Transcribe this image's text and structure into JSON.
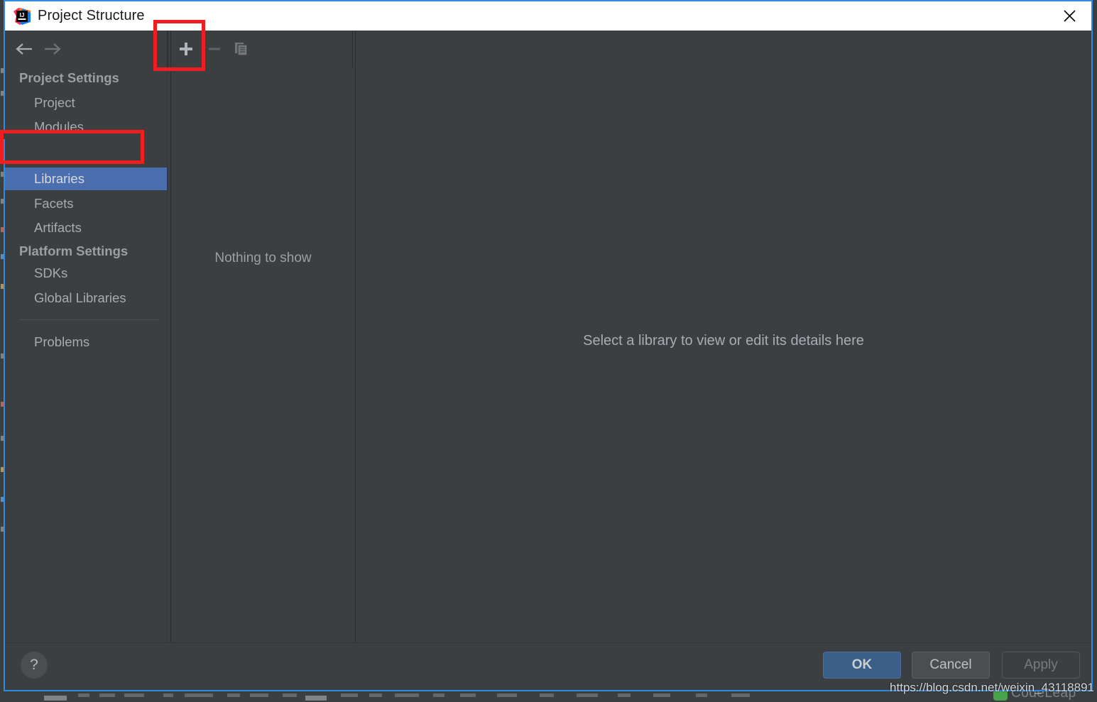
{
  "window": {
    "title": "Project Structure",
    "app_icon": "intellij-idea-logo",
    "close_icon": "close-icon"
  },
  "toolbar": {
    "back_icon": "arrow-left-icon",
    "forward_icon": "arrow-right-icon",
    "add_icon": "plus-icon",
    "remove_icon": "minus-icon",
    "copy_icon": "copy-icon"
  },
  "sidebar": {
    "groups": [
      {
        "label": "Project Settings"
      },
      {
        "label": "Platform Settings"
      }
    ],
    "items": [
      {
        "label": "Project",
        "selected": false
      },
      {
        "label": "Modules",
        "selected": false
      },
      {
        "label": "Libraries",
        "selected": true
      },
      {
        "label": "Facets",
        "selected": false
      },
      {
        "label": "Artifacts",
        "selected": false
      },
      {
        "label": "SDKs",
        "selected": false
      },
      {
        "label": "Global Libraries",
        "selected": false
      },
      {
        "label": "Problems",
        "selected": false
      }
    ]
  },
  "list_panel": {
    "empty_text": "Nothing to show"
  },
  "detail_panel": {
    "empty_text": "Select a library to view or edit its details here"
  },
  "buttons": {
    "help": "?",
    "ok": "OK",
    "cancel": "Cancel",
    "apply": "Apply"
  },
  "watermark": {
    "text": "https://blog.csdn.net/weixin_43118891"
  },
  "background_window": {
    "partial_text": "CodeLeap"
  },
  "colors": {
    "dialog_bg": "#3c3f41",
    "titlebar_bg": "#ffffff",
    "dialog_border": "#2d8ce0",
    "selection_blue": "#4b6eaf",
    "ok_button": "#3c5f8a",
    "annotation_red": "#f01f1f",
    "text_primary": "#a6abb0",
    "text_muted": "#767b7f"
  }
}
